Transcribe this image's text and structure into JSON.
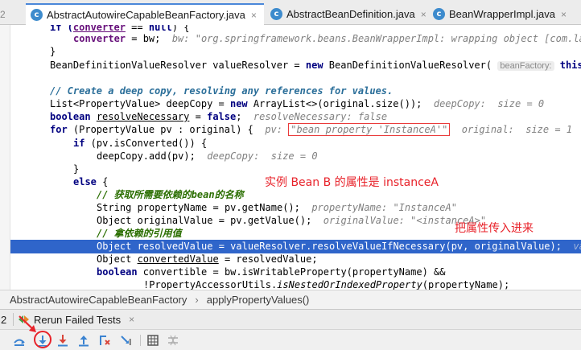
{
  "tabs": [
    {
      "label": "2"
    },
    {
      "label": "AbstractAutowireCapableBeanFactory.java",
      "close": "×",
      "icon": "class-c-icon",
      "active": true
    },
    {
      "label": "AbstractBeanDefinition.java",
      "close": "×",
      "icon": "class-c-icon"
    },
    {
      "label": "BeanWrapperImpl.java",
      "close": "×",
      "icon": "class-c-icon"
    }
  ],
  "code": {
    "l1": {
      "a": "if (",
      "b": "converter",
      "c": " == ",
      "d": "null",
      "e": ") {"
    },
    "l2": {
      "a": "converter",
      "b": " = bw;  ",
      "hint": "bw: \"org.springframework.beans.BeanWrapperImpl: wrapping object [com.lagou.edu.InstanceB"
    },
    "l3": {
      "a": "}"
    },
    "l4": {
      "a": "BeanDefinitionValueResolver valueResolver = ",
      "b": "new",
      "c": " BeanDefinitionValueResolver( ",
      "tag": "beanFactory:",
      "d": " this, be"
    },
    "l5": {
      "a": ""
    },
    "l6": {
      "a": "// Create a deep copy, resolving any references for values."
    },
    "l7": {
      "a": "List<PropertyValue> deepCopy = ",
      "b": "new",
      "c": " ArrayList<>(original.size());  ",
      "hint": "deepCopy:  size = 0"
    },
    "l8": {
      "a": "boolean",
      "b": " ",
      "c": "resolveNecessary",
      "d": " = ",
      "e": "false",
      "f": ";  ",
      "hint": "resolveNecessary: false"
    },
    "l9": {
      "a": "for",
      "b": " (PropertyValue pv : original) {  ",
      "hint1": "pv: ",
      "boxed": "\"bean property 'InstanceA'\"",
      "hint2": "  original:  size = 1"
    },
    "l10": {
      "a": "if",
      "b": " (pv.isConverted()) {"
    },
    "l11": {
      "a": "deepCopy.add(pv);  ",
      "hint": "deepCopy:  size = 0"
    },
    "l12": {
      "a": "}"
    },
    "l13": {
      "a": "else",
      "b": " {"
    },
    "l14": {
      "a": "// 获取所需要依赖的bean的名称"
    },
    "l15": {
      "a": "String propertyName = pv.getName();  ",
      "hint": "propertyName: \"InstanceA\""
    },
    "l16": {
      "a": "Object originalValue = pv.getValue();  ",
      "hint": "originalValue: \"<instanceA>\""
    },
    "l17": {
      "a": "// 拿依赖的引用值"
    },
    "l18": {
      "a": "Object resolvedValue = valueResolver.resolveValueIfNecessary(pv, originalValue);  ",
      "hint": "valu"
    },
    "l19": {
      "a": "Object ",
      "b": "convertedValue",
      "c": " = resolvedValue;"
    },
    "l20": {
      "a": "boolean",
      "b": " convertible = bw.isWritableProperty(propertyName) &&"
    },
    "l21": {
      "a": "!PropertyAccessorUtils.",
      "b": "isNestedOrIndexedProperty",
      "c": "(propertyName);"
    }
  },
  "annotations": {
    "a1": "实例 Bean B 的属性是 instanceA",
    "a2": "把属性传入进来"
  },
  "breadcrumb": {
    "class": "AbstractAutowireCapableBeanFactory",
    "sep": "›",
    "method": "applyPropertyValues()"
  },
  "runbar": {
    "num": "2",
    "label": "Rerun Failed Tests",
    "close": "×"
  },
  "toolbar": {
    "icons": [
      "show-execution-point-icon",
      "step-over-icon",
      "step-into-icon",
      "force-step-into-icon",
      "step-out-icon",
      "drop-frame-icon",
      "run-to-cursor-icon",
      "evaluate-expression-icon",
      "trace-icon"
    ]
  },
  "colors": {
    "accent": "#2f65ca",
    "annotation": "#e8222a",
    "keyword": "#000080",
    "comment": "#2a6e00"
  }
}
